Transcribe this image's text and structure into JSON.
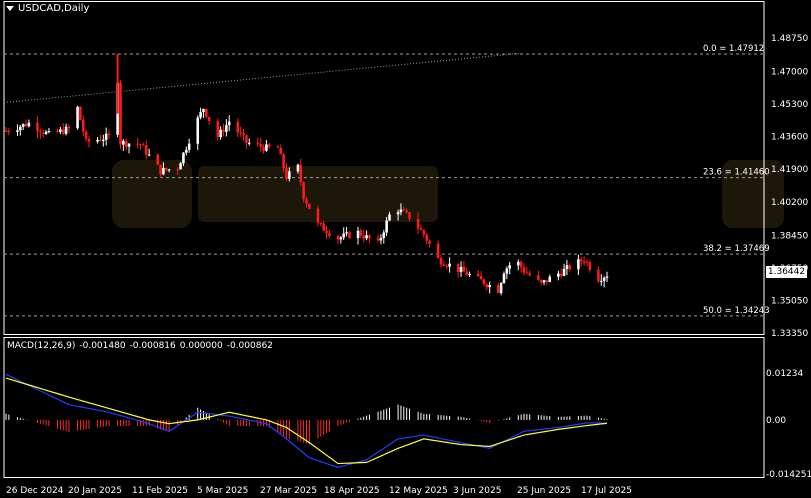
{
  "header": {
    "symbol_timeframe": "USDCAD,Daily"
  },
  "current_price": "1.36442",
  "price_axis_labels": [
    "1.48750",
    "1.47000",
    "1.45300",
    "1.43600",
    "1.41900",
    "1.40200",
    "1.38450",
    "1.36750",
    "1.35050",
    "1.33350"
  ],
  "macd_axis_labels": [
    "0.01234",
    "0.00",
    "-0.014251"
  ],
  "date_labels": [
    "26 Dec 2024",
    "20 Jan 2025",
    "11 Feb 2025",
    "5 Mar 2025",
    "27 Mar 2025",
    "18 Apr 2025",
    "12 May 2025",
    "3 Jun 2025",
    "25 Jun 2025",
    "17 Jul 2025"
  ],
  "fib_levels": [
    {
      "label": "0.0 = 1.47912",
      "value": 1.47912
    },
    {
      "label": "23.6 = 1.41460",
      "value": 1.4146
    },
    {
      "label": "38.2 = 1.37469",
      "value": 1.37469
    },
    {
      "label": "50.0 = 1.34243",
      "value": 1.34243
    }
  ],
  "macd_header": {
    "name": "MACD(12,26,9)",
    "v1": "-0.001480",
    "v2": "-0.000816",
    "v3": "0.000000",
    "v4": "-0.000862"
  },
  "colors": {
    "background": "#000000",
    "bull_candle": "#ffffff",
    "bear_candle": "#ff1a1a",
    "fib_line": "#9a9a9a",
    "macd_line": "#1f3cff",
    "signal_line": "#ffff33",
    "hist_positive": "#ffffff",
    "hist_negative": "#ff2a2a",
    "text": "#ffffff"
  },
  "chart_data": {
    "type": "candlestick",
    "title": "USDCAD,Daily",
    "price_range": [
      1.3335,
      1.4875
    ],
    "price_key_points": [
      {
        "date": "2024-12-26",
        "close": 1.439
      },
      {
        "date": "2025-01-03",
        "close": 1.443
      },
      {
        "date": "2025-01-10",
        "close": 1.437
      },
      {
        "date": "2025-01-17",
        "close": 1.44
      },
      {
        "date": "2025-01-20",
        "close": 1.451
      },
      {
        "date": "2025-01-23",
        "close": 1.433
      },
      {
        "date": "2025-01-31",
        "close": 1.436
      },
      {
        "date": "2025-02-03",
        "close": 1.466
      },
      {
        "date": "2025-02-04",
        "close": 1.433
      },
      {
        "date": "2025-02-11",
        "close": 1.432
      },
      {
        "date": "2025-02-18",
        "close": 1.418
      },
      {
        "date": "2025-02-24",
        "close": 1.42
      },
      {
        "date": "2025-03-03",
        "close": 1.445
      },
      {
        "date": "2025-03-05",
        "close": 1.451
      },
      {
        "date": "2025-03-10",
        "close": 1.436
      },
      {
        "date": "2025-03-14",
        "close": 1.444
      },
      {
        "date": "2025-03-20",
        "close": 1.433
      },
      {
        "date": "2025-03-27",
        "close": 1.43
      },
      {
        "date": "2025-03-31",
        "close": 1.43
      },
      {
        "date": "2025-04-03",
        "close": 1.415
      },
      {
        "date": "2025-04-07",
        "close": 1.42
      },
      {
        "date": "2025-04-09",
        "close": 1.405
      },
      {
        "date": "2025-04-14",
        "close": 1.39
      },
      {
        "date": "2025-04-21",
        "close": 1.383
      },
      {
        "date": "2025-04-28",
        "close": 1.386
      },
      {
        "date": "2025-05-05",
        "close": 1.38
      },
      {
        "date": "2025-05-09",
        "close": 1.395
      },
      {
        "date": "2025-05-12",
        "close": 1.398
      },
      {
        "date": "2025-05-16",
        "close": 1.394
      },
      {
        "date": "2025-05-21",
        "close": 1.385
      },
      {
        "date": "2025-05-26",
        "close": 1.372
      },
      {
        "date": "2025-06-03",
        "close": 1.366
      },
      {
        "date": "2025-06-11",
        "close": 1.36
      },
      {
        "date": "2025-06-16",
        "close": 1.356
      },
      {
        "date": "2025-06-18",
        "close": 1.366
      },
      {
        "date": "2025-06-22",
        "close": 1.372
      },
      {
        "date": "2025-06-25",
        "close": 1.366
      },
      {
        "date": "2025-07-01",
        "close": 1.359
      },
      {
        "date": "2025-07-04",
        "close": 1.362
      },
      {
        "date": "2025-07-10",
        "close": 1.367
      },
      {
        "date": "2025-07-16",
        "close": 1.372
      },
      {
        "date": "2025-07-21",
        "close": 1.362
      },
      {
        "date": "2025-07-24",
        "close": 1.364
      }
    ],
    "macd_range": [
      -0.014251,
      0.01234
    ],
    "macd_key_points": [
      {
        "date": "2024-12-26",
        "macd": 0.012,
        "signal": 0.011
      },
      {
        "date": "2025-01-17",
        "macd": 0.004,
        "signal": 0.006
      },
      {
        "date": "2025-01-31",
        "macd": 0.002,
        "signal": 0.003
      },
      {
        "date": "2025-02-14",
        "macd": -0.001,
        "signal": 0.0
      },
      {
        "date": "2025-02-21",
        "macd": -0.003,
        "signal": -0.001
      },
      {
        "date": "2025-03-03",
        "macd": 0.002,
        "signal": 0.0
      },
      {
        "date": "2025-03-14",
        "macd": 0.001,
        "signal": 0.002
      },
      {
        "date": "2025-03-27",
        "macd": -0.001,
        "signal": 0.0
      },
      {
        "date": "2025-04-03",
        "macd": -0.005,
        "signal": -0.002
      },
      {
        "date": "2025-04-11",
        "macd": -0.01,
        "signal": -0.006
      },
      {
        "date": "2025-04-21",
        "macd": -0.0125,
        "signal": -0.0115
      },
      {
        "date": "2025-05-01",
        "macd": -0.0105,
        "signal": -0.0112
      },
      {
        "date": "2025-05-12",
        "macd": -0.005,
        "signal": -0.0075
      },
      {
        "date": "2025-05-21",
        "macd": -0.004,
        "signal": -0.005
      },
      {
        "date": "2025-06-03",
        "macd": -0.006,
        "signal": -0.0065
      },
      {
        "date": "2025-06-13",
        "macd": -0.0075,
        "signal": -0.007
      },
      {
        "date": "2025-06-25",
        "macd": -0.003,
        "signal": -0.004
      },
      {
        "date": "2025-07-07",
        "macd": -0.002,
        "signal": -0.0025
      },
      {
        "date": "2025-07-17",
        "macd": -0.0008,
        "signal": -0.0015
      },
      {
        "date": "2025-07-24",
        "macd": -0.0008,
        "signal": -0.0009
      }
    ],
    "grid": false
  }
}
